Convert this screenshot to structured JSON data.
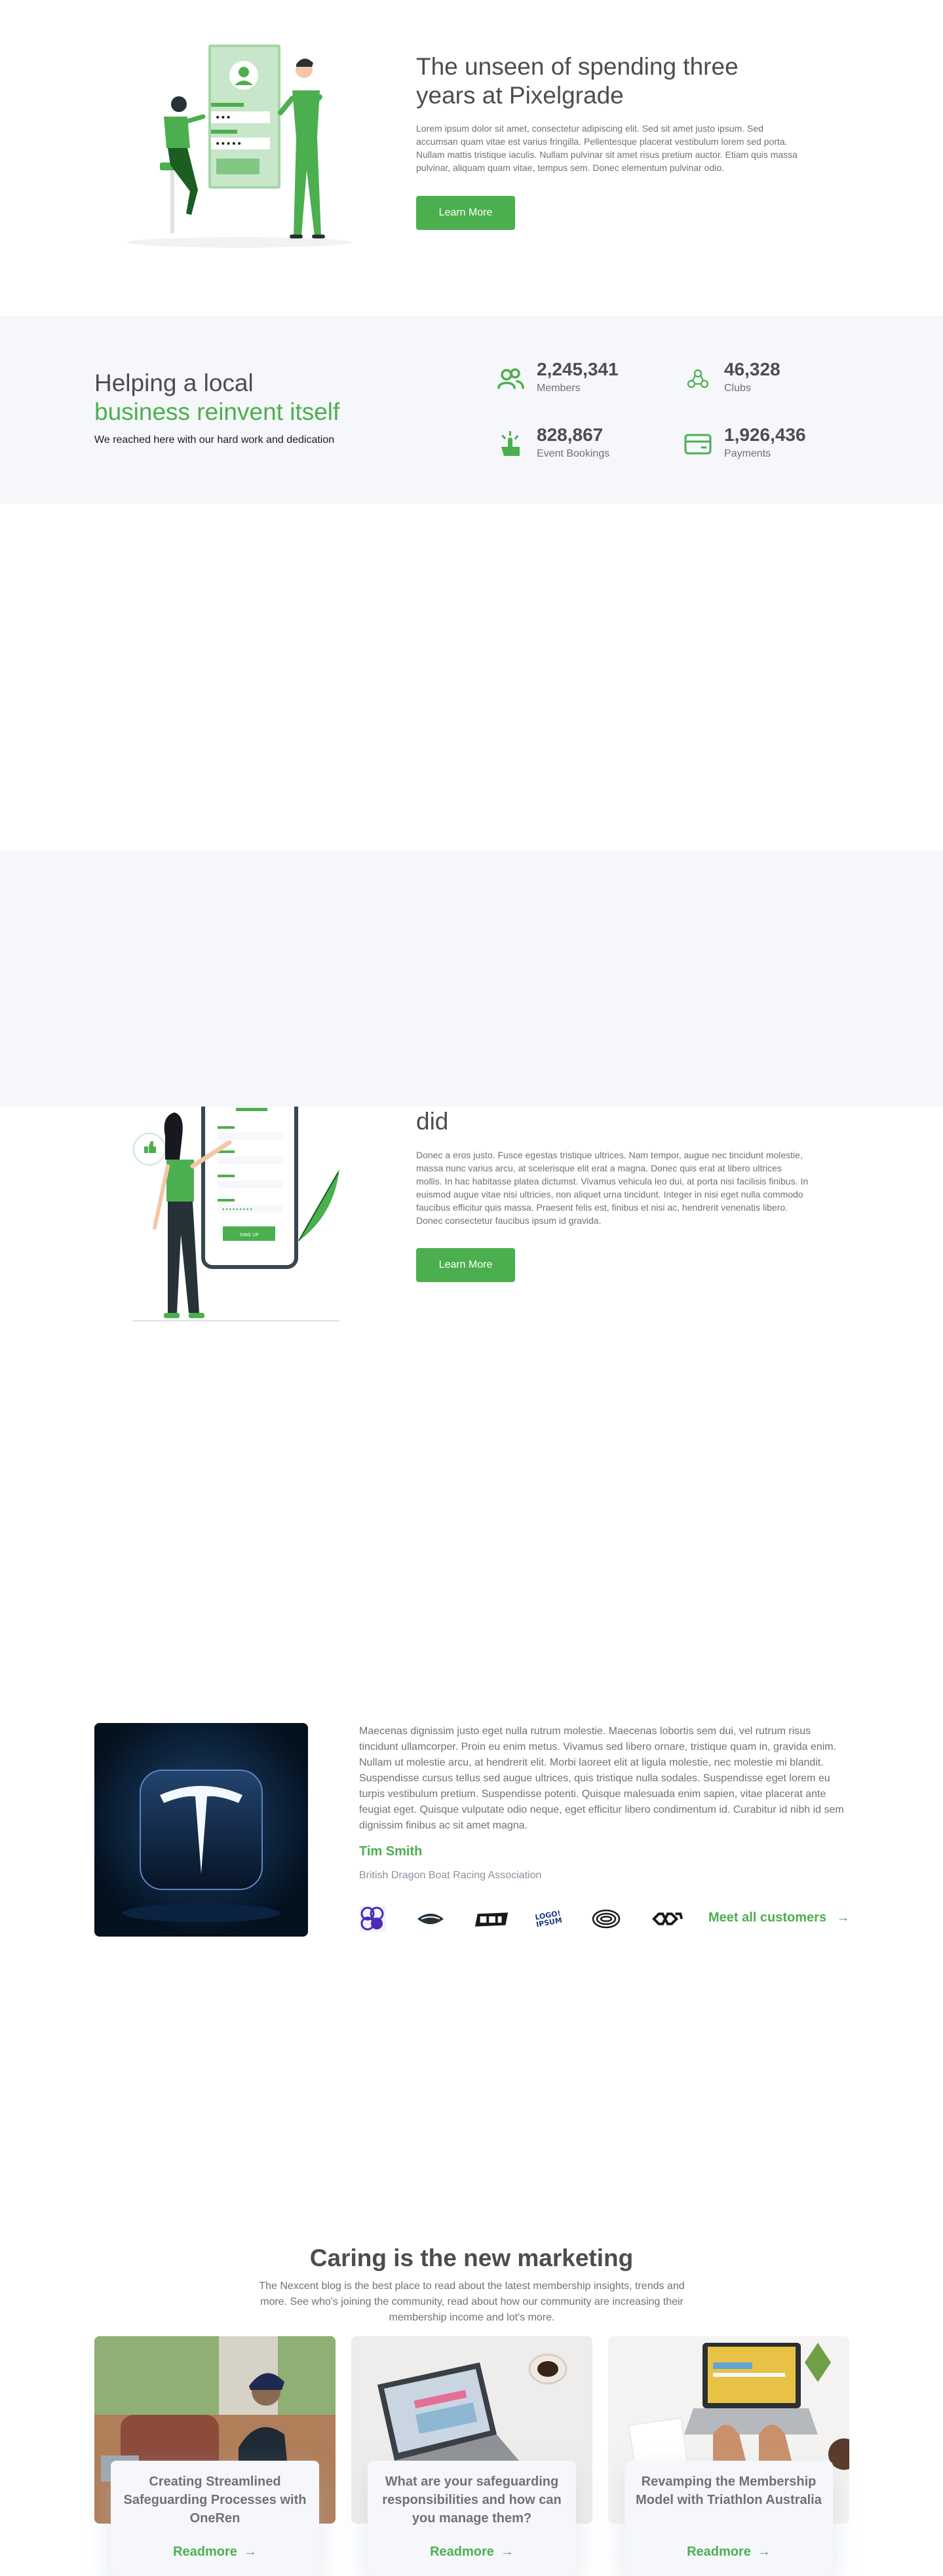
{
  "hero": {
    "title": "The unseen of spending three years at Pixelgrade",
    "body": "Lorem ipsum dolor sit amet, consectetur adipiscing elit. Sed sit amet justo ipsum. Sed accumsan quam vitae est varius fringilla. Pellentesque placerat vestibulum lorem sed porta. Nullam mattis tristique iaculis. Nullam pulvinar sit amet risus pretium auctor. Etiam quis massa pulvinar, aliquam quam vitae, tempus sem. Donec elementum pulvinar odio.",
    "button": "Learn More"
  },
  "stats": {
    "title_line1": "Helping a local",
    "title_line2": "business reinvent itself",
    "subtitle": "We reached here with our hard work and dedication",
    "items": [
      {
        "value": "2,245,341",
        "label": "Members",
        "icon": "members-icon"
      },
      {
        "value": "46,328",
        "label": "Clubs",
        "icon": "clubs-icon"
      },
      {
        "value": "828,867",
        "label": "Event Bookings",
        "icon": "click-icon"
      },
      {
        "value": "1,926,436",
        "label": "Payments",
        "icon": "payment-icon"
      }
    ]
  },
  "feature": {
    "title": "How to design your site footer like we did",
    "body": "Donec a eros justo. Fusce egestas tristique ultrices. Nam tempor, augue nec tincidunt molestie, massa nunc varius arcu, at scelerisque elit erat a magna. Donec quis erat at libero ultrices mollis. In hac habitasse platea dictumst. Vivamus vehicula leo dui, at porta nisi facilisis finibus. In euismod augue vitae nisi ultricies, non aliquet urna tincidunt. Integer in nisi eget nulla commodo faucibus efficitur quis massa. Praesent felis est, finibus et nisi ac, hendrerit venenatis libero. Donec consectetur faucibus ipsum id gravida.",
    "button": "Learn More",
    "phone_button": "SING UP"
  },
  "testimonial": {
    "quote": "Maecenas dignissim justo eget nulla rutrum molestie. Maecenas lobortis sem dui, vel rutrum risus tincidunt ullamcorper. Proin eu enim metus. Vivamus sed libero ornare, tristique quam in, gravida enim. Nullam ut molestie arcu, at hendrerit elit. Morbi laoreet elit at ligula molestie, nec molestie mi blandit. Suspendisse cursus tellus sed augue ultrices, quis tristique nulla sodales. Suspendisse eget lorem eu turpis vestibulum pretium. Suspendisse potenti. Quisque malesuada enim sapien, vitae placerat ante feugiat eget. Quisque vulputate odio neque, eget efficitur libero condimentum id. Curabitur id nibh id sem dignissim finibus ac sit amet magna.",
    "name": "Tim Smith",
    "organization": "British Dragon Boat Racing Association",
    "meet_link": "Meet all customers",
    "logo_text": "LOGO! IPSUM"
  },
  "blog": {
    "title": "Caring is the new marketing",
    "description": "The Nexcent blog is the best place to read about the latest membership insights, trends and more. See who's joining the community, read about how our community are increasing their membership income and lot's more.",
    "cards": [
      {
        "title": "Creating Streamlined Safeguarding Processes with OneRen",
        "link": "Readmore"
      },
      {
        "title": "What are your safeguarding responsibilities and how can you manage them?",
        "link": "Readmore"
      },
      {
        "title": "Revamping the Membership Model with Triathlon Australia",
        "link": "Readmore"
      }
    ]
  },
  "colors": {
    "primary": "#4CAF4F",
    "heading": "#4D4D4D",
    "body": "#717171",
    "silver": "#F5F7FA"
  }
}
